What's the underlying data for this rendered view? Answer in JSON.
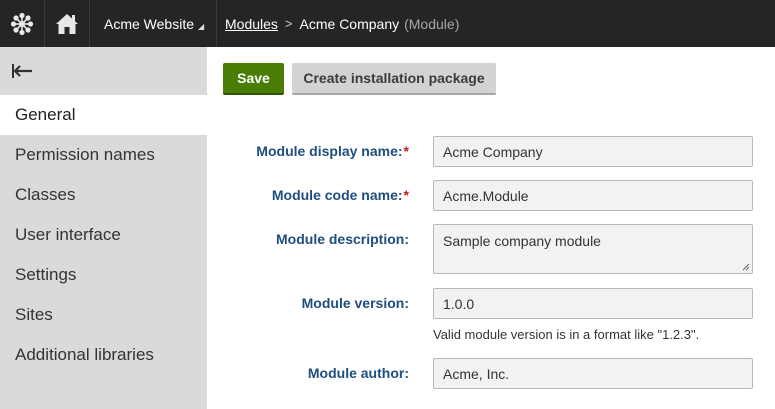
{
  "topbar": {
    "logo_icon": "kentico-logo-icon",
    "home_icon": "home-icon",
    "site_name": "Acme Website",
    "breadcrumb": {
      "link": "Modules",
      "current": "Acme Company",
      "type": "(Module)"
    }
  },
  "sidebar": {
    "back_icon": "arrow-left-icon",
    "items": [
      {
        "label": "General",
        "active": true
      },
      {
        "label": "Permission names",
        "active": false
      },
      {
        "label": "Classes",
        "active": false
      },
      {
        "label": "User interface",
        "active": false
      },
      {
        "label": "Settings",
        "active": false
      },
      {
        "label": "Sites",
        "active": false
      },
      {
        "label": "Additional libraries",
        "active": false
      }
    ]
  },
  "toolbar": {
    "save_label": "Save",
    "package_label": "Create installation package"
  },
  "form": {
    "display_name": {
      "label": "Module display name:",
      "required_mark": "*",
      "value": "Acme Company"
    },
    "code_name": {
      "label": "Module code name:",
      "required_mark": "*",
      "value": "Acme.Module"
    },
    "description": {
      "label": "Module description:",
      "value": "Sample company module"
    },
    "version": {
      "label": "Module version:",
      "value": "1.0.0",
      "hint": "Valid module version is in a format like \"1.2.3\"."
    },
    "author": {
      "label": "Module author:",
      "value": "Acme, Inc."
    }
  },
  "colors": {
    "topbar_bg": "#262524",
    "sidebar_bg": "#d9dbd8",
    "save_button": "#497d04",
    "label_text": "#1e4e80",
    "required_mark": "#c21e1e"
  }
}
